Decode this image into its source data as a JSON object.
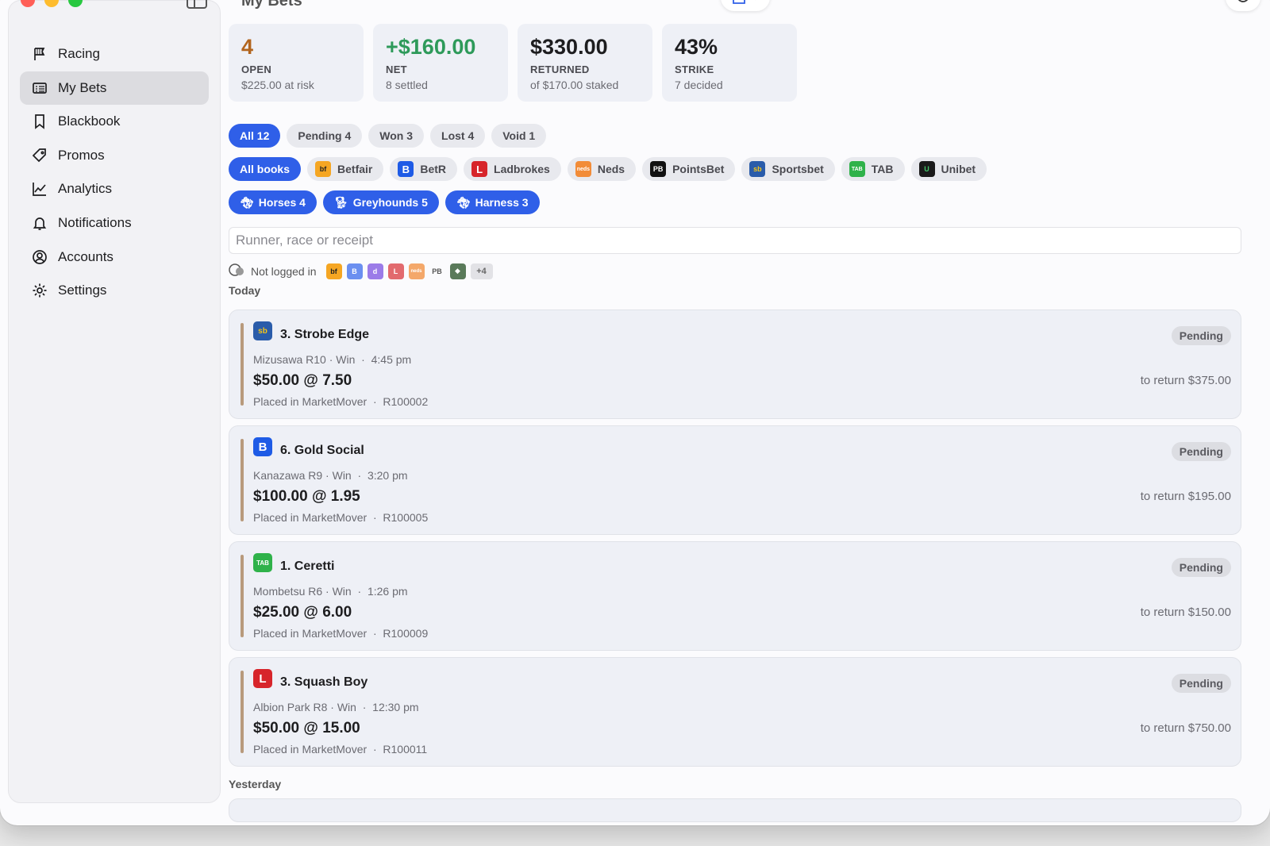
{
  "window": {
    "title": "My Bets"
  },
  "sidebar": {
    "items": [
      {
        "label": "Racing",
        "icon": "flag-icon"
      },
      {
        "label": "My Bets",
        "icon": "list-icon",
        "active": true
      },
      {
        "label": "Blackbook",
        "icon": "bookmark-icon"
      },
      {
        "label": "Promos",
        "icon": "tag-icon"
      },
      {
        "label": "Analytics",
        "icon": "chart-icon"
      },
      {
        "label": "Notifications",
        "icon": "bell-icon"
      },
      {
        "label": "Accounts",
        "icon": "person-icon"
      },
      {
        "label": "Settings",
        "icon": "gear-icon"
      }
    ]
  },
  "stats": [
    {
      "value": "4",
      "label": "OPEN",
      "sub": "$225.00 at risk",
      "color": "#b2651e"
    },
    {
      "value": "+$160.00",
      "label": "NET",
      "sub": "8 settled",
      "color": "#2e9a5a"
    },
    {
      "value": "$330.00",
      "label": "RETURNED",
      "sub": "of $170.00 staked",
      "color": "#1d1d1f"
    },
    {
      "value": "43%",
      "label": "STRIKE",
      "sub": "7 decided",
      "color": "#1d1d1f"
    }
  ],
  "status_filters": [
    "All 12",
    "Pending 4",
    "Won 3",
    "Lost 4",
    "Void 1"
  ],
  "book_filters": [
    {
      "label": "All books"
    },
    {
      "label": "Betfair",
      "color": "#f5a623",
      "glyph": "bf"
    },
    {
      "label": "BetR",
      "color": "#1e5be6",
      "glyph": "B"
    },
    {
      "label": "Ladbrokes",
      "color": "#d7252b",
      "glyph": "L"
    },
    {
      "label": "Neds",
      "color": "#f28c38",
      "glyph": "neds"
    },
    {
      "label": "PointsBet",
      "color": "#111111",
      "glyph": "PB"
    },
    {
      "label": "Sportsbet",
      "color": "#2a5caa",
      "glyph": "sb"
    },
    {
      "label": "TAB",
      "color": "#2fb24a",
      "glyph": "TAB"
    },
    {
      "label": "Unibet",
      "color": "#1a1a1a",
      "glyph": "U"
    }
  ],
  "code_filters": [
    "Horses 4",
    "Greyhounds 5",
    "Harness 3"
  ],
  "search": {
    "placeholder": "Runner, race or receipt"
  },
  "login_status": {
    "label": "Not logged in",
    "more": "+4"
  },
  "sections": {
    "today": "Today",
    "yesterday": "Yesterday"
  },
  "bets": [
    {
      "runner": "3. Strobe Edge",
      "race": "Mizusawa R10 · Win",
      "time": "4:45 pm",
      "stake": "$50.00 @ 7.50",
      "placed": "Placed in MarketMover",
      "receipt": "R100002",
      "status": "Pending",
      "return": "to return $375.00",
      "book": "sb",
      "book_color": "#2a5caa"
    },
    {
      "runner": "6. Gold Social",
      "race": "Kanazawa R9 · Win",
      "time": "3:20 pm",
      "stake": "$100.00 @ 1.95",
      "placed": "Placed in MarketMover",
      "receipt": "R100005",
      "status": "Pending",
      "return": "to return $195.00",
      "book": "B",
      "book_color": "#1e5be6"
    },
    {
      "runner": "1. Ceretti",
      "race": "Mombetsu R6 · Win",
      "time": "1:26 pm",
      "stake": "$25.00 @ 6.00",
      "placed": "Placed in MarketMover",
      "receipt": "R100009",
      "status": "Pending",
      "return": "to return $150.00",
      "book": "TAB",
      "book_color": "#2fb24a"
    },
    {
      "runner": "3. Squash Boy",
      "race": "Albion Park R8 · Win",
      "time": "12:30 pm",
      "stake": "$50.00 @ 15.00",
      "placed": "Placed in MarketMover",
      "receipt": "R100011",
      "status": "Pending",
      "return": "to return $750.00",
      "book": "L",
      "book_color": "#d7252b"
    }
  ]
}
